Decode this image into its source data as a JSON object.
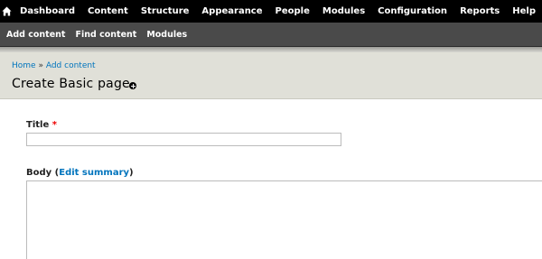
{
  "toolbar": {
    "home_icon": "home-icon",
    "menu": [
      "Dashboard",
      "Content",
      "Structure",
      "Appearance",
      "People",
      "Modules",
      "Configuration",
      "Reports",
      "Help"
    ]
  },
  "shortcuts": [
    "Add content",
    "Find content",
    "Modules"
  ],
  "breadcrumb": {
    "home": "Home",
    "separator": "»",
    "add_content": "Add content"
  },
  "page": {
    "title": "Create Basic page",
    "add_shortcut_icon": "plus-circle-icon"
  },
  "form": {
    "title_label": "Title",
    "title_required": "*",
    "title_value": "",
    "body_label": "Body",
    "body_open": "(",
    "edit_summary": "Edit summary",
    "body_close": ")",
    "body_value": ""
  },
  "colors": {
    "toolbar_bg": "#000000",
    "shortcut_bg": "#4a4a4a",
    "header_bg": "#e0e0d8",
    "link": "#0074bd",
    "required": "#ee0000"
  }
}
